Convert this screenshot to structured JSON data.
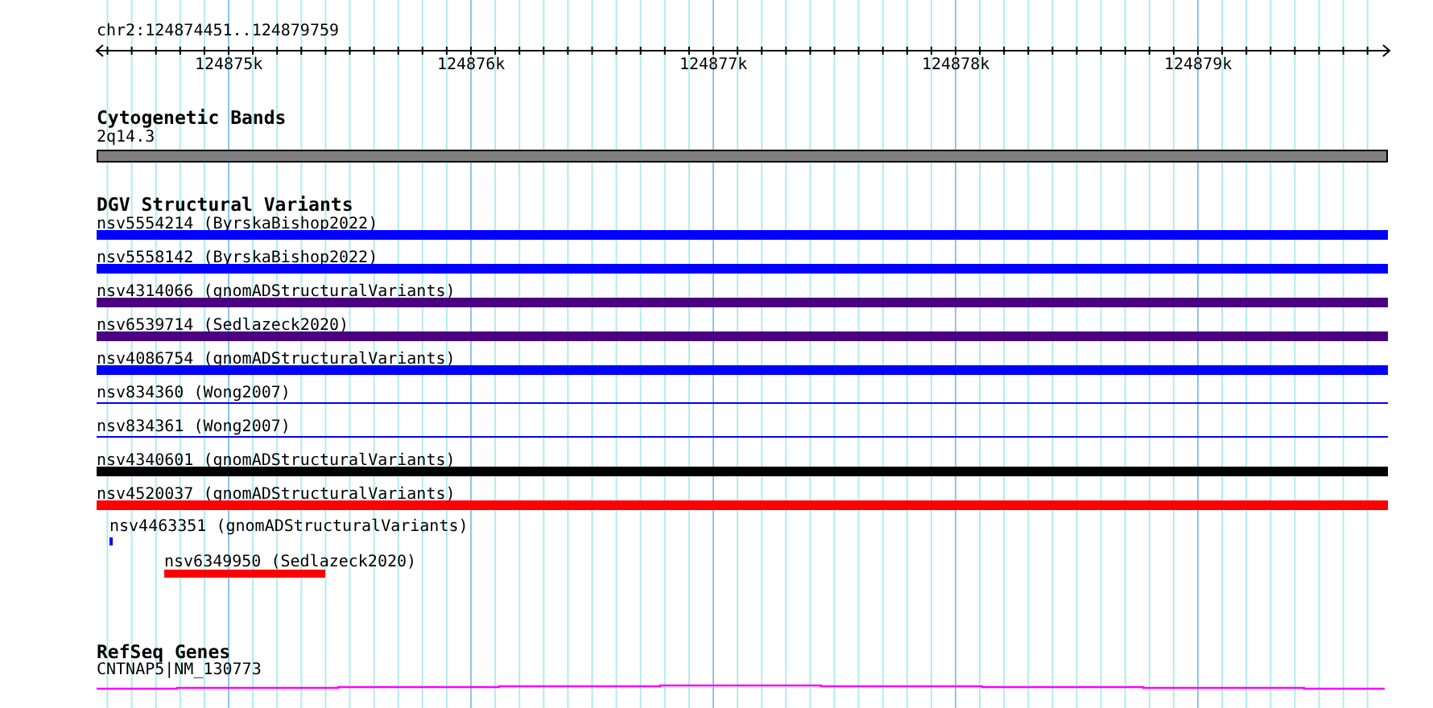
{
  "locus": "chr2:124874451..124879759",
  "ruler": {
    "ticks": [
      "124875k",
      "124876k",
      "124877k",
      "124878k",
      "124879k"
    ]
  },
  "tracks": [
    {
      "title": "Cytogenetic Bands",
      "features": [
        {
          "label": "2q14.3",
          "color": "#808080",
          "kind": "band"
        }
      ]
    },
    {
      "title": "DGV Structural Variants",
      "features": [
        {
          "label": "nsv5554214 (ByrskaBishop2022)",
          "color": "#0000ff",
          "kind": "thick"
        },
        {
          "label": "nsv5558142 (ByrskaBishop2022)",
          "color": "#0000ff",
          "kind": "thick"
        },
        {
          "label": "nsv4314066 (gnomADStructuralVariants)",
          "color": "#4b0082",
          "kind": "thick"
        },
        {
          "label": "nsv6539714 (Sedlazeck2020)",
          "color": "#4b0082",
          "kind": "thick"
        },
        {
          "label": "nsv4086754 (gnomADStructuralVariants)",
          "color": "#0000ff",
          "kind": "thick"
        },
        {
          "label": "nsv834360 (Wong2007)",
          "color": "#0000ff",
          "kind": "thin"
        },
        {
          "label": "nsv834361 (Wong2007)",
          "color": "#0000ff",
          "kind": "thin"
        },
        {
          "label": "nsv4340601 (gnomADStructuralVariants)",
          "color": "#000000",
          "kind": "thick"
        },
        {
          "label": "nsv4520037 (gnomADStructuralVariants)",
          "color": "#ff0000",
          "kind": "thick"
        },
        {
          "label": "nsv4463351 (gnomADStructuralVariants)",
          "color": "#0000ff",
          "kind": "tick"
        },
        {
          "label": "nsv6349950 (Sedlazeck2020)",
          "color": "#ff0000",
          "kind": "short"
        }
      ]
    },
    {
      "title": "RefSeq Genes",
      "features": [
        {
          "label": "CNTNAP5|NM_130773",
          "color": "#ff00ff",
          "kind": "gene"
        }
      ]
    }
  ]
}
